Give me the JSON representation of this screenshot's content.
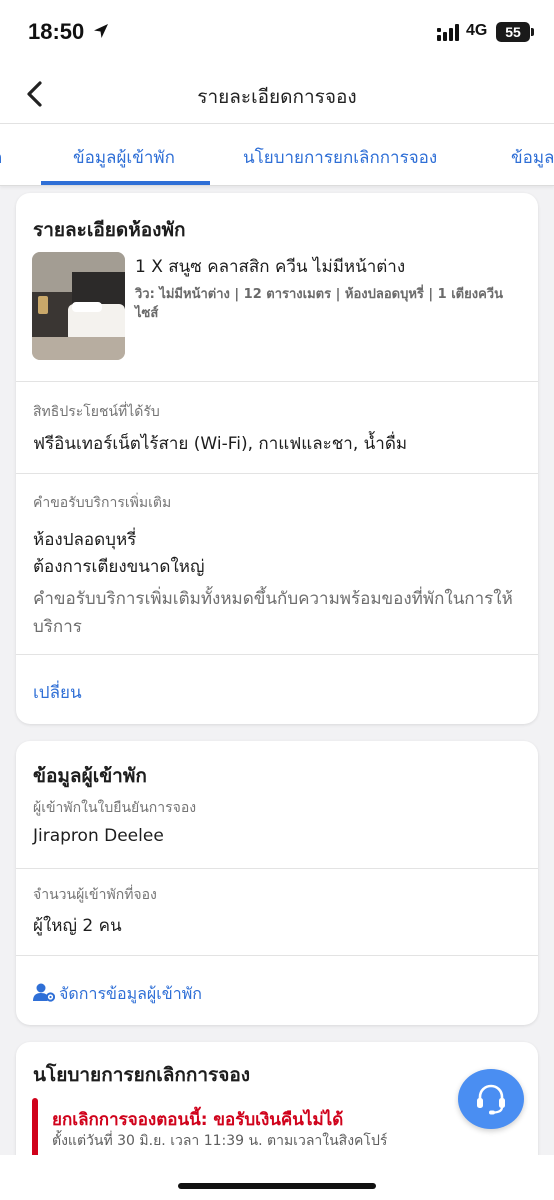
{
  "status_bar": {
    "time": "18:50",
    "network": "4G",
    "battery": "55"
  },
  "header": {
    "title": "รายละเอียดการจอง"
  },
  "tabs": [
    {
      "label": "ก"
    },
    {
      "label": "ข้อมูลผู้เข้าพัก"
    },
    {
      "label": "นโยบายการยกเลิกการจอง"
    },
    {
      "label": "ข้อมูล"
    }
  ],
  "room_card": {
    "title": "รายละเอียดห้องพัก",
    "room_name": "1 X สนูซ คลาสสิก ควีน ไม่มีหน้าต่าง",
    "room_desc": "วิว: ไม่มีหน้าต่าง | 12 ตารางเมตร | ห้องปลอดบุหรี่ | 1 เตียงควีนไซส์",
    "benefits_label": "สิทธิประโยชน์ที่ได้รับ",
    "benefits_value": "ฟรีอินเทอร์เน็ตไร้สาย (Wi-Fi), กาแฟและชา, น้ำดื่ม",
    "requests_label": "คำขอรับบริการเพิ่มเติม",
    "request_1": "ห้องปลอดบุหรี่",
    "request_2": "ต้องการเตียงขนาดใหญ่",
    "requests_note": "คำขอรับบริการเพิ่มเติมทั้งหมดขึ้นกับความพร้อมของที่พักในการให้บริการ",
    "change_label": "เปลี่ยน"
  },
  "guest_card": {
    "title": "ข้อมูลผู้เข้าพัก",
    "guest_label": "ผู้เข้าพักในใบยืนยันการจอง",
    "guest_name": "Jirapron Deelee",
    "count_label": "จำนวนผู้เข้าพักที่จอง",
    "count_value": "ผู้ใหญ่ 2 คน",
    "manage_label": "จัดการข้อมูลผู้เข้าพัก"
  },
  "policy_card": {
    "title": "นโยบายการยกเลิกการจอง",
    "status": "ยกเลิกการจองตอนนี้: ขอรับเงินคืนไม่ได้",
    "since": "ตั้งแต่วันที่ 30 มิ.ย. เวลา 11:39 น. ตามเวลาในสิงคโปร์"
  },
  "colors": {
    "accent": "#2f6fd6",
    "alert": "#d0021b",
    "fab": "#4a8ef2"
  },
  "icons": {
    "back": "chevron-left-icon",
    "support": "headset-icon",
    "guest": "person-gear-icon"
  }
}
